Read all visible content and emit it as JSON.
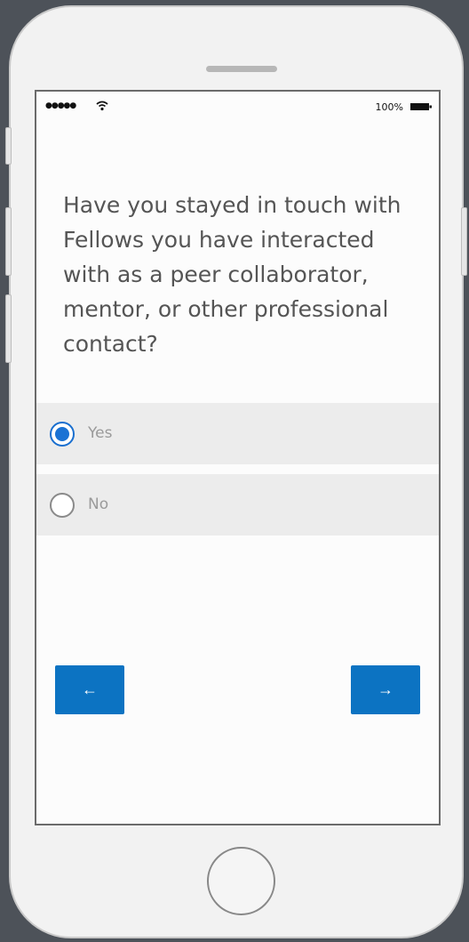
{
  "status_bar": {
    "signal": "●●●●●",
    "battery_percent": "100%",
    "icons": [
      "signal-icon",
      "wifi-icon",
      "battery-icon"
    ]
  },
  "survey": {
    "question": "Have you stayed in touch with Fellows you have interacted with as a peer collaborator, mentor, or other professional contact?",
    "options": [
      {
        "label": "Yes",
        "selected": true
      },
      {
        "label": "No",
        "selected": false
      }
    ]
  },
  "navigation": {
    "back_label": "←",
    "next_label": "→",
    "back_icon": "arrow-left-icon",
    "next_icon": "arrow-right-icon"
  },
  "colors": {
    "accent": "#0c73c2",
    "radio_selected": "#1a72d4",
    "option_background": "#ececec",
    "question_text": "#555555",
    "option_text": "#9a9a9a",
    "background": "#4d5259"
  }
}
